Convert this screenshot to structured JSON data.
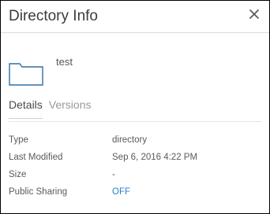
{
  "dialog": {
    "title": "Directory Info",
    "close_icon": "close-icon"
  },
  "item": {
    "icon": "folder-icon",
    "name": "test"
  },
  "tabs": [
    {
      "label": "Details",
      "active": true
    },
    {
      "label": "Versions",
      "active": false
    }
  ],
  "properties": [
    {
      "key": "Type",
      "value": "directory"
    },
    {
      "key": "Last Modified",
      "value": "Sep 6, 2016 4:22 PM"
    },
    {
      "key": "Size",
      "value": "-"
    },
    {
      "key": "Public Sharing",
      "value": "OFF"
    }
  ],
  "colors": {
    "link": "#2f80c5",
    "folder_outline": "#2f6fa6"
  }
}
